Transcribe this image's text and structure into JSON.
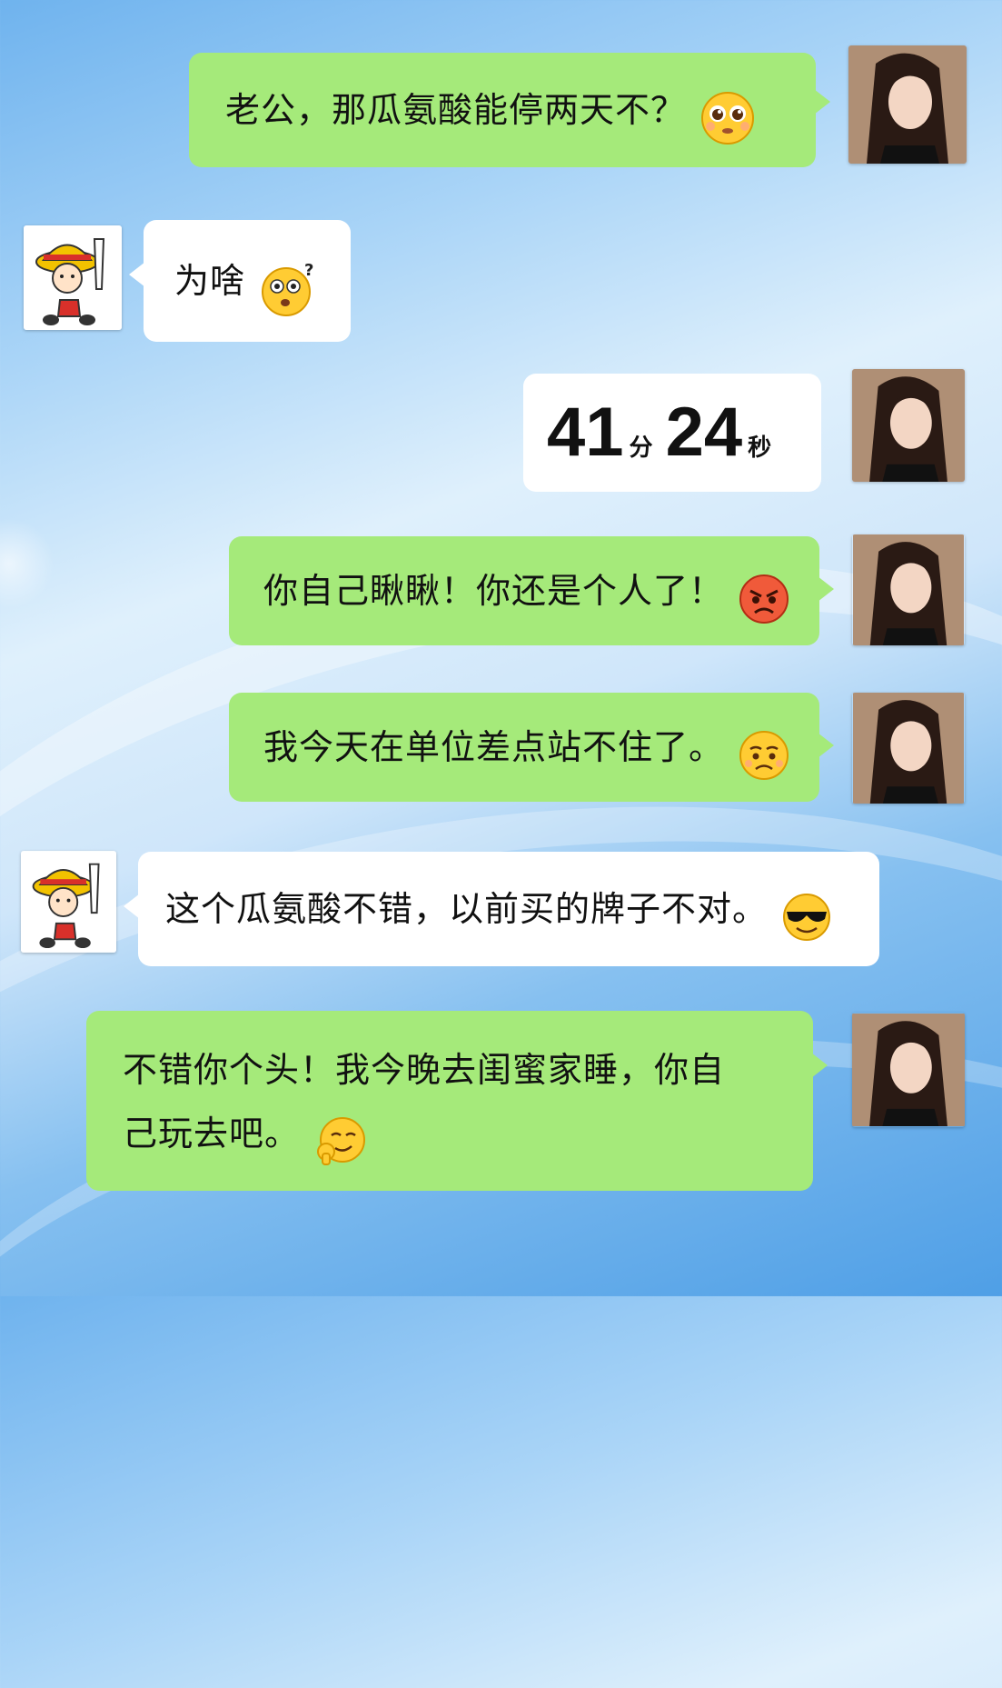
{
  "messages": [
    {
      "sender": "her",
      "text": "老公，那瓜氨酸能停两天不？",
      "emoji": "pleading-emoji"
    },
    {
      "sender": "him",
      "text": "为啥",
      "emoji": "confused-emoji"
    },
    {
      "sender": "her",
      "timer": {
        "minutes": "41",
        "minutes_unit": "分",
        "seconds": "24",
        "seconds_unit": "秒"
      }
    },
    {
      "sender": "her",
      "text": "你自己瞅瞅！你还是个人了！",
      "emoji": "angry-emoji"
    },
    {
      "sender": "her",
      "text": "我今天在单位差点站不住了。",
      "emoji": "sad-emoji"
    },
    {
      "sender": "him",
      "text": "这个瓜氨酸不错，以前买的牌子不对。",
      "emoji": "cool-sunglasses-emoji"
    },
    {
      "sender": "her",
      "text_line1": "不错你个头！我今晚去闺蜜家睡，你自",
      "text_line2": "己玩去吧。",
      "emoji": "thinking-emoji"
    }
  ],
  "colors": {
    "green_bubble": "#a5ea7a",
    "white_bubble": "#ffffff",
    "text": "#111111"
  }
}
